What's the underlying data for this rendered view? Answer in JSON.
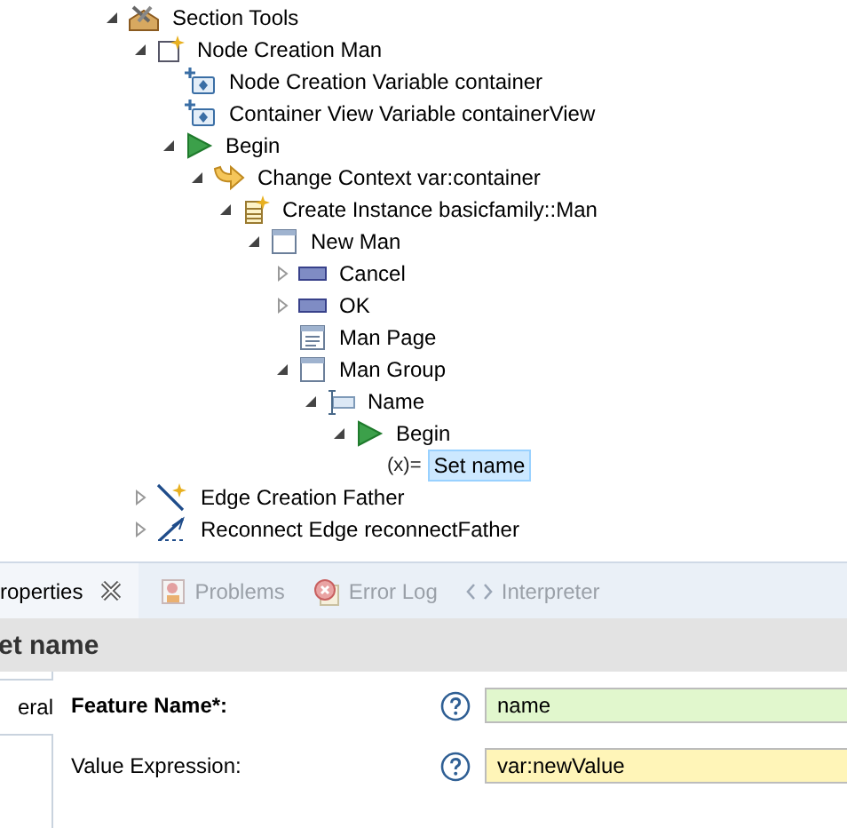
{
  "tree": [
    {
      "label": "Section Tools",
      "kind": "tools",
      "expanded": true,
      "selected": false,
      "children": [
        {
          "label": "Node Creation Man",
          "kind": "node-creation",
          "expanded": true,
          "selected": false,
          "children": [
            {
              "label": "Node Creation Variable container",
              "kind": "variable",
              "selected": false
            },
            {
              "label": "Container View Variable containerView",
              "kind": "variable",
              "selected": false
            },
            {
              "label": "Begin",
              "kind": "begin",
              "expanded": true,
              "selected": false,
              "children": [
                {
                  "label": "Change Context var:container",
                  "kind": "change-context",
                  "expanded": true,
                  "selected": false,
                  "children": [
                    {
                      "label": "Create Instance basicfamily::Man",
                      "kind": "create-instance",
                      "expanded": true,
                      "selected": false,
                      "children": [
                        {
                          "label": "New Man",
                          "kind": "dialog",
                          "expanded": true,
                          "selected": false,
                          "children": [
                            {
                              "label": "Cancel",
                              "kind": "button",
                              "expanded": false,
                              "selected": false
                            },
                            {
                              "label": "OK",
                              "kind": "button",
                              "expanded": false,
                              "selected": false
                            },
                            {
                              "label": "Man Page",
                              "kind": "page",
                              "selected": false
                            },
                            {
                              "label": "Man Group",
                              "kind": "dialog",
                              "expanded": true,
                              "selected": false,
                              "children": [
                                {
                                  "label": "Name",
                                  "kind": "text-widget",
                                  "expanded": true,
                                  "selected": false,
                                  "children": [
                                    {
                                      "label": "Begin",
                                      "kind": "begin",
                                      "expanded": true,
                                      "selected": false,
                                      "children": [
                                        {
                                          "label": "Set name",
                                          "kind": "set",
                                          "icon_text": "(x)=",
                                          "selected": true
                                        }
                                      ]
                                    }
                                  ]
                                }
                              ]
                            }
                          ]
                        }
                      ]
                    }
                  ]
                }
              ]
            }
          ]
        },
        {
          "label": "Edge Creation Father",
          "kind": "edge-creation",
          "expanded": false,
          "selected": false
        },
        {
          "label": "Reconnect Edge reconnectFather",
          "kind": "reconnect",
          "expanded": false,
          "selected": false
        }
      ]
    }
  ],
  "view_tabs": [
    {
      "label": "roperties",
      "kind": "plain",
      "selected": true,
      "closable": true
    },
    {
      "label": "Problems",
      "kind": "problems",
      "selected": false,
      "closable": false
    },
    {
      "label": "Error Log",
      "kind": "error-log",
      "selected": false,
      "closable": false
    },
    {
      "label": "Interpreter",
      "kind": "interpreter",
      "selected": false,
      "closable": false
    }
  ],
  "properties": {
    "title": "et name",
    "side_tabs": [
      {
        "label": "eral",
        "selected": true
      }
    ],
    "fields": [
      {
        "label": "Feature Name*:",
        "required": true,
        "value": "name",
        "color": "#e1f7cd"
      },
      {
        "label": "Value Expression:",
        "required": false,
        "value": "var:newValue",
        "color": "#fff5b8"
      }
    ]
  }
}
